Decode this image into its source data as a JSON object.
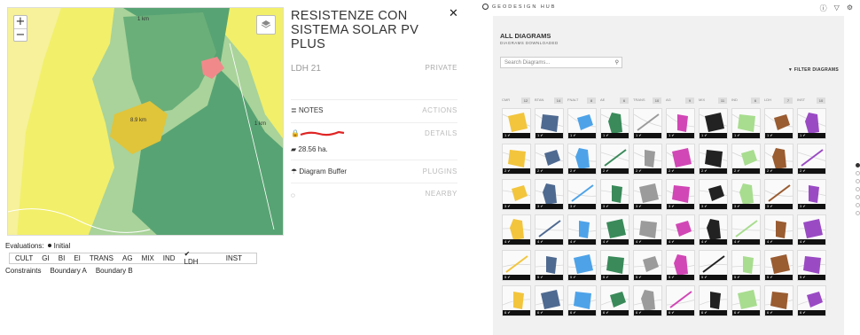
{
  "map": {
    "zoom_in": "+",
    "zoom_out": "−",
    "labels": [
      "1 km",
      "1 km"
    ],
    "parcel_label": "8.9 km"
  },
  "evaluations": {
    "label": "Evaluations:",
    "selected": "Initial",
    "tabs": [
      "CULT",
      "GI",
      "BI",
      "EI",
      "TRANS",
      "AG",
      "MIX",
      "IND",
      "LDH",
      "INST"
    ],
    "checked_tab": "LDH",
    "constraints": [
      "Constraints",
      "Boundary A",
      "Boundary B"
    ]
  },
  "detail": {
    "title": "RESISTENZE CON SISTEMA SOLAR PV PLUS",
    "code": "LDH 21",
    "visibility": "PRIVATE",
    "close": "✕",
    "sections": [
      {
        "left": "NOTES",
        "right": "ACTIONS"
      },
      {
        "left": "",
        "right": "DETAILS"
      },
      {
        "left": "Diagram Buffer",
        "right": "PLUGINS"
      },
      {
        "left": "",
        "right": "NEARBY"
      }
    ],
    "area": "28.56 ha."
  },
  "hub": {
    "logo": "GEODESIGN HUB",
    "heading": "ALL DIAGRAMS",
    "subheading": "DIAGRAMS DOWNLOADED",
    "search_placeholder": "Search Diagrams...",
    "filter_label": "▼ FILTER DIAGRAMS",
    "columns": [
      {
        "code": "CMR",
        "count": "12"
      },
      {
        "code": "BTAN",
        "count": "14"
      },
      {
        "code": "FNALT",
        "count": "8"
      },
      {
        "code": "AE",
        "count": "6"
      },
      {
        "code": "TRANS",
        "count": "10"
      },
      {
        "code": "AG",
        "count": "9"
      },
      {
        "code": "MIX",
        "count": "11"
      },
      {
        "code": "IND",
        "count": "6"
      },
      {
        "code": "LDH",
        "count": "7"
      },
      {
        "code": "INST",
        "count": "10"
      }
    ],
    "row_tags": [
      "1 ✔",
      "2 ✔",
      "3 ✔",
      "4 ✔",
      "5 ✔",
      "6 ✔"
    ],
    "colors": {
      "yellow": "#f2c53d",
      "navy": "#4f6a91",
      "blue": "#4ea3e8",
      "green": "#3a8a5a",
      "grey": "#9b9b9b",
      "magenta": "#d147b5",
      "black": "#222222",
      "lightgreen": "#a8dd8f",
      "brown": "#9a5c31",
      "purple": "#9a4bc4"
    }
  }
}
